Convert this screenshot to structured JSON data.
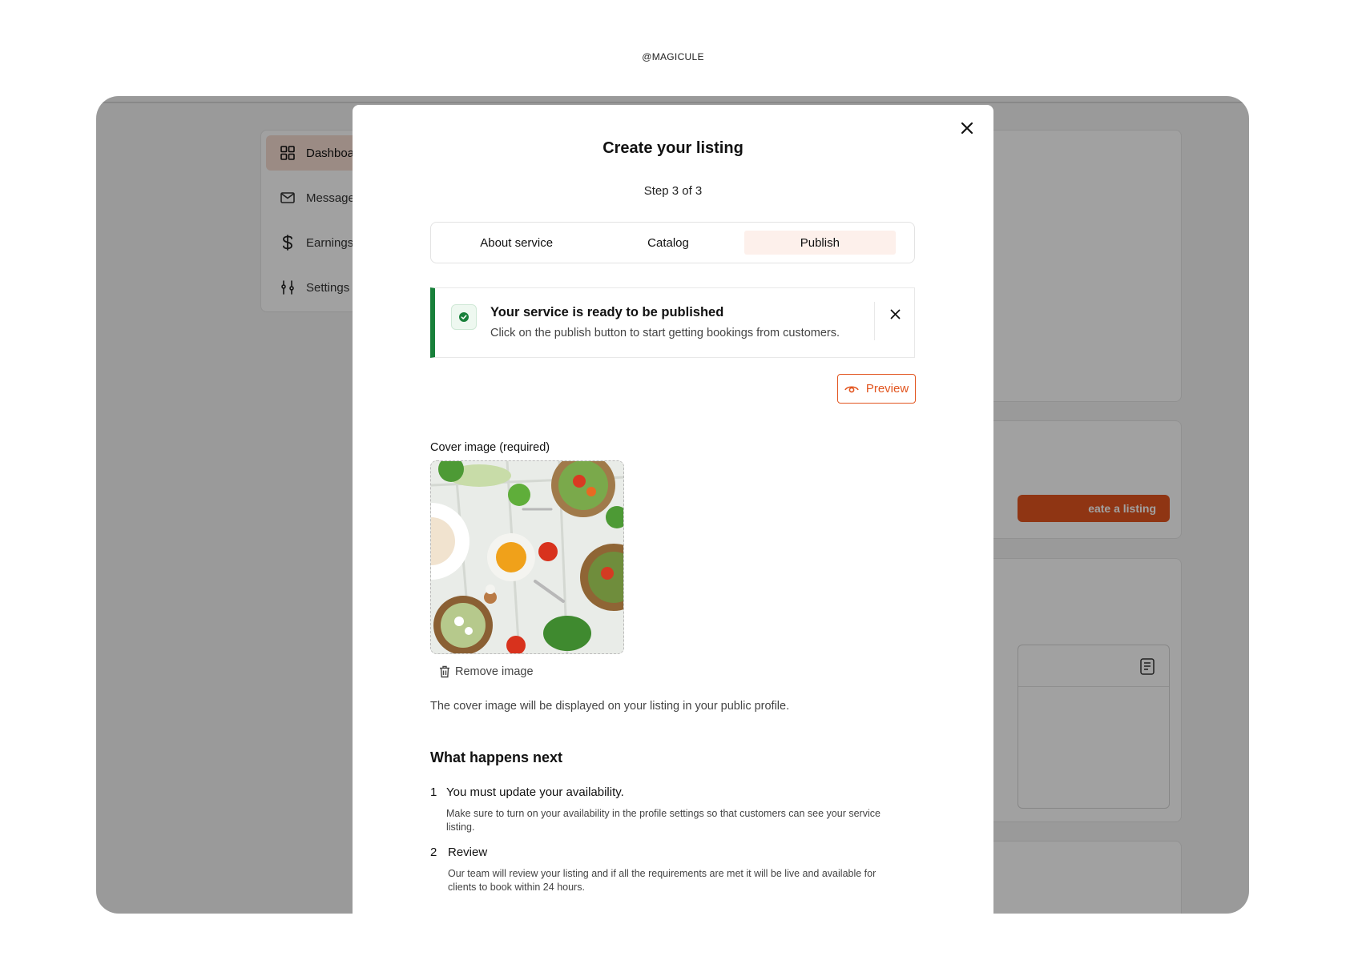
{
  "watermark": "@MAGICULE",
  "sidebar": {
    "items": [
      {
        "label": "Dashboa",
        "icon": "grid-icon",
        "active": true
      },
      {
        "label": "Message",
        "icon": "mail-icon",
        "active": false
      },
      {
        "label": "Earnings",
        "icon": "dollar-icon",
        "active": false
      },
      {
        "label": "Settings",
        "icon": "sliders-icon",
        "active": false
      }
    ]
  },
  "background": {
    "create_listing_label": "eate a listing"
  },
  "modal": {
    "title": "Create your listing",
    "step": "Step 3 of 3",
    "tabs": [
      {
        "label": "About service",
        "active": false
      },
      {
        "label": "Catalog",
        "active": false
      },
      {
        "label": "Publish",
        "active": true
      }
    ],
    "alert": {
      "title": "Your service is ready to be published",
      "description": "Click on the publish button to start getting bookings from customers.",
      "accent_color": "#18803a"
    },
    "preview_label": "Preview",
    "cover": {
      "label": "Cover image (required)",
      "remove_label": "Remove image",
      "help": "The cover image will be displayed on your listing in your public profile."
    },
    "next": {
      "title": "What happens next",
      "steps": [
        {
          "num": "1",
          "title": "You must update your availability.",
          "desc": "Make sure to turn on your availability in the profile settings so that customers can see your service listing."
        },
        {
          "num": "2",
          "title": "Review",
          "desc": "Our team will review your listing and if all the requirements are met it will be live and available for clients to book within 24 hours."
        }
      ]
    }
  },
  "colors": {
    "accent": "#e2551f",
    "success": "#18803a",
    "active_tab_bg": "#fdf0eb"
  }
}
